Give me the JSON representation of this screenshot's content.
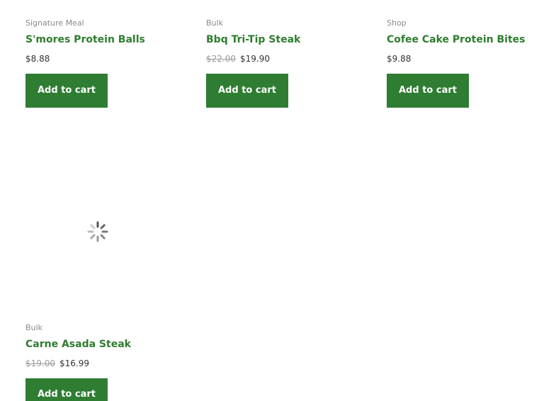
{
  "products": [
    {
      "category": "Signature Meal",
      "title": "S'mores Protein Balls",
      "old_price": "",
      "price": "$8.88",
      "button_label": "Add to cart"
    },
    {
      "category": "Bulk",
      "title": "Bbq Tri-Tip Steak",
      "old_price": "$22.00",
      "price": "$19.90",
      "button_label": "Add to cart"
    },
    {
      "category": "Shop",
      "title": "Cofee Cake Protein Bites",
      "old_price": "",
      "price": "$9.88",
      "button_label": "Add to cart"
    },
    {
      "category": "Bulk",
      "title": "Carne Asada Steak",
      "old_price": "$19.00",
      "price": "$16.99",
      "button_label": "Add to cart",
      "image_loading": true
    }
  ],
  "colors": {
    "title_green": "#2e7d2e",
    "button_green": "#2e7d32",
    "category_gray": "#8a8a8a"
  }
}
